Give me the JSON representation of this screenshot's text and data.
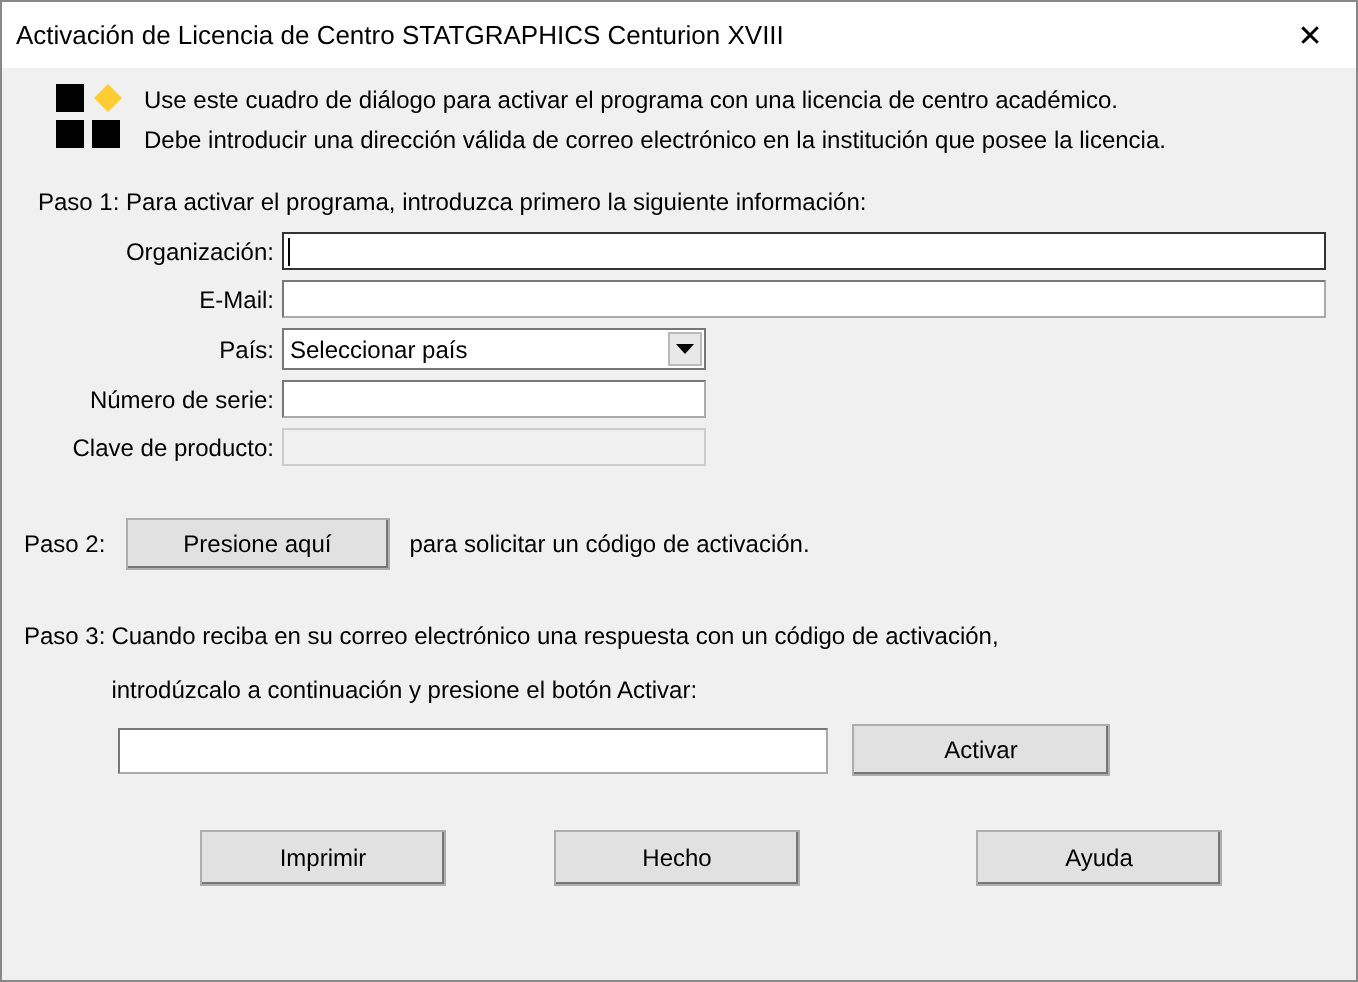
{
  "window": {
    "title": "Activación de Licencia de Centro STATGRAPHICS Centurion XVIII",
    "close": "✕"
  },
  "notes": [
    "Use este cuadro de diálogo para activar el programa con una licencia de centro académico.",
    "Debe introducir una dirección válida de correo electrónico en la institución que posee la licencia."
  ],
  "step1": {
    "label": "Paso 1: Para activar el programa, introduzca primero la siguiente información:",
    "fields": [
      {
        "label": "Organización:",
        "kind": "wide",
        "disabled": false,
        "focused": true
      },
      {
        "label": "E-Mail:",
        "kind": "wide",
        "disabled": false,
        "focused": false
      },
      {
        "label": "País:",
        "kind": "dropdown",
        "value": "Seleccionar país"
      },
      {
        "label": "Número de serie:",
        "kind": "short",
        "disabled": false,
        "focused": false
      },
      {
        "label": "Clave de producto:",
        "kind": "short",
        "disabled": true,
        "focused": false
      }
    ]
  },
  "step2": {
    "label": "Paso 2:",
    "button": "Presione aquí",
    "text": "para solicitar un código de activación."
  },
  "step3": {
    "label": "Paso 3:",
    "line1": "Cuando reciba en su correo electrónico una respuesta con un código de activación,",
    "line2": "introdúzcalo a continuación y presione el botón Activar:",
    "button": "Activar"
  },
  "buttons": [
    "Imprimir",
    "Hecho",
    "Ayuda"
  ]
}
